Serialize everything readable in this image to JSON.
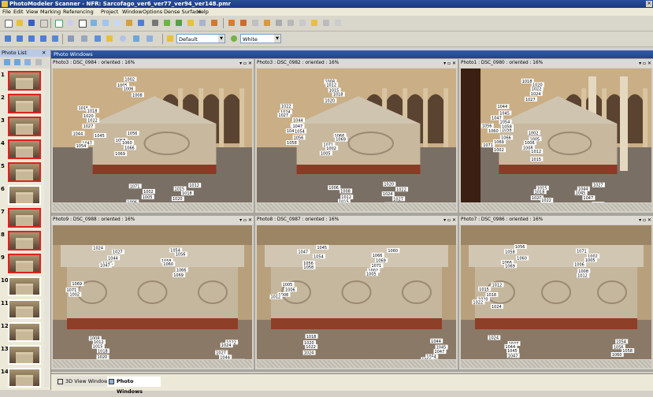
{
  "app": {
    "title": "PhotoModeler Scanner - NFR: Sarcofago_ver6_ver77_ver94_ver148.pmr"
  },
  "menu": [
    "File",
    "Edit",
    "View",
    "Marking",
    "Referencing",
    "Project",
    "Window",
    "Options",
    "Dense Surface",
    "Help"
  ],
  "toolbar": {
    "style_value": "Default",
    "color_value": "White"
  },
  "photo_list": {
    "title": "Photo List",
    "items": [
      {
        "num": "1",
        "selected": true
      },
      {
        "num": "2",
        "selected": true
      },
      {
        "num": "3",
        "selected": true
      },
      {
        "num": "4",
        "selected": true
      },
      {
        "num": "5",
        "selected": true
      },
      {
        "num": "6",
        "selected": false
      },
      {
        "num": "7",
        "selected": true
      },
      {
        "num": "8",
        "selected": true
      },
      {
        "num": "9",
        "selected": true
      },
      {
        "num": "10",
        "selected": false
      },
      {
        "num": "11",
        "selected": false
      },
      {
        "num": "12",
        "selected": false
      },
      {
        "num": "13",
        "selected": false
      },
      {
        "num": "14",
        "selected": false
      }
    ]
  },
  "photo_windows": {
    "title": "Photo Windows",
    "windows": [
      {
        "title": "Photo3 : DSC_0984 : oriented : 16%"
      },
      {
        "title": "Photo3 : DSC_0982 : oriented : 16%"
      },
      {
        "title": "Photo1 : DSC_0980 : oriented : 16%"
      },
      {
        "title": "Photo9 : DSC_0988 : oriented : 16%"
      },
      {
        "title": "Photo8 : DSC_0987 : oriented : 16%"
      },
      {
        "title": "Photo7 : DSC_0986 : oriented : 16%"
      }
    ]
  },
  "window_controls": "▾ ▫ ✕",
  "bottom_tabs": [
    "3D View Windows",
    "Photo Windows"
  ],
  "point_labels": [
    "1002",
    "1005",
    "1006",
    "1008",
    "1012",
    "1015",
    "1018",
    "1020",
    "1022",
    "1024",
    "1027",
    "1044",
    "1045",
    "1047",
    "1054",
    "1056",
    "1058",
    "1060",
    "1066",
    "1069",
    "1071"
  ]
}
